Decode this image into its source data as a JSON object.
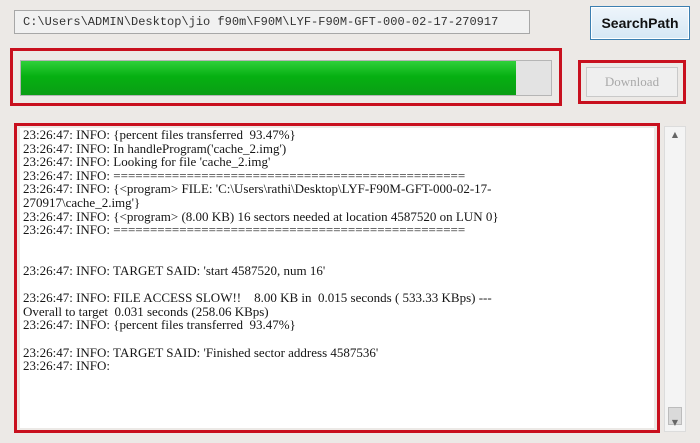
{
  "path_field": {
    "value": "C:\\Users\\ADMIN\\Desktop\\jio f90m\\F90M\\LYF-F90M-GFT-000-02-17-270917"
  },
  "search_button": {
    "label": "SearchPath"
  },
  "progress": {
    "percent": 93.47,
    "color": "#06b012"
  },
  "download_button": {
    "label": "Download",
    "enabled": false
  },
  "log": {
    "lines": [
      "23:26:47: INFO: {percent files transferred  93.47%}",
      "23:26:47: INFO: In handleProgram('cache_2.img')",
      "23:26:47: INFO: Looking for file 'cache_2.img'",
      "23:26:47: INFO: ================================================",
      "23:26:47: INFO: {<program> FILE: 'C:\\Users\\rathi\\Desktop\\LYF-F90M-GFT-000-02-17-",
      "270917\\cache_2.img'}",
      "23:26:47: INFO: {<program> (8.00 KB) 16 sectors needed at location 4587520 on LUN 0}",
      "23:26:47: INFO: ================================================",
      "",
      "",
      "23:26:47: INFO: TARGET SAID: 'start 4587520, num 16'",
      "",
      "23:26:47: INFO: FILE ACCESS SLOW!!    8.00 KB in  0.015 seconds ( 533.33 KBps) ---",
      "Overall to target  0.031 seconds (258.06 KBps)",
      "23:26:47: INFO: {percent files transferred  93.47%}",
      "",
      "23:26:47: INFO: TARGET SAID: 'Finished sector address 4587536'",
      "23:26:47: INFO:"
    ]
  },
  "highlight_color": "#c8101e"
}
